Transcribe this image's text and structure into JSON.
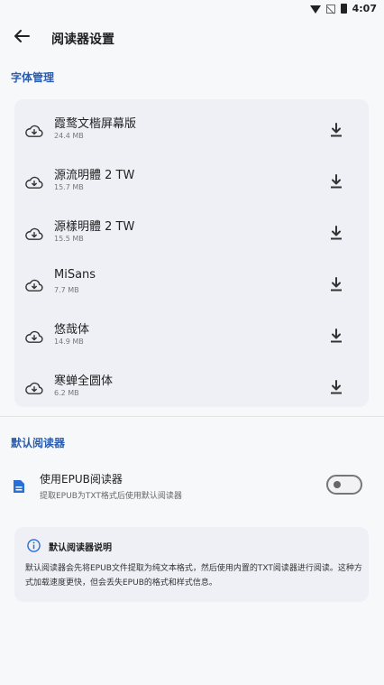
{
  "status_bar": {
    "time": "4:07",
    "wifi_icon": "wifi-icon",
    "signal_icon": "no-signal-icon",
    "battery_icon": "battery-icon"
  },
  "app_bar": {
    "title": "阅读器设置",
    "back_icon": "arrow-back-icon"
  },
  "fonts_section": {
    "title": "字体管理",
    "items": [
      {
        "name": "霞鹜文楷屏幕版",
        "size": "24.4 MB"
      },
      {
        "name": "源流明體 2 TW",
        "size": "15.7 MB"
      },
      {
        "name": "源樣明體 2 TW",
        "size": "15.5 MB"
      },
      {
        "name": "MiSans",
        "size": "7.7 MB"
      },
      {
        "name": "悠哉体",
        "size": "14.9 MB"
      },
      {
        "name": "寒蝉全圆体",
        "size": "6.2 MB"
      }
    ]
  },
  "reader_section": {
    "title": "默认阅读器",
    "epub_setting": {
      "label": "使用EPUB阅读器",
      "description": "提取EPUB为TXT格式后使用默认阅读器",
      "enabled": false
    },
    "note": {
      "title": "默认阅读器说明",
      "text": "默认阅读器会先将EPUB文件提取为纯文本格式，然后使用内置的TXT阅读器进行阅读。这种方式加载速度更快，但会丢失EPUB的格式和样式信息。"
    }
  },
  "colors": {
    "accent": "#2a5db0",
    "card_bg": "#eef0f6",
    "page_bg": "#f7f8fa"
  }
}
